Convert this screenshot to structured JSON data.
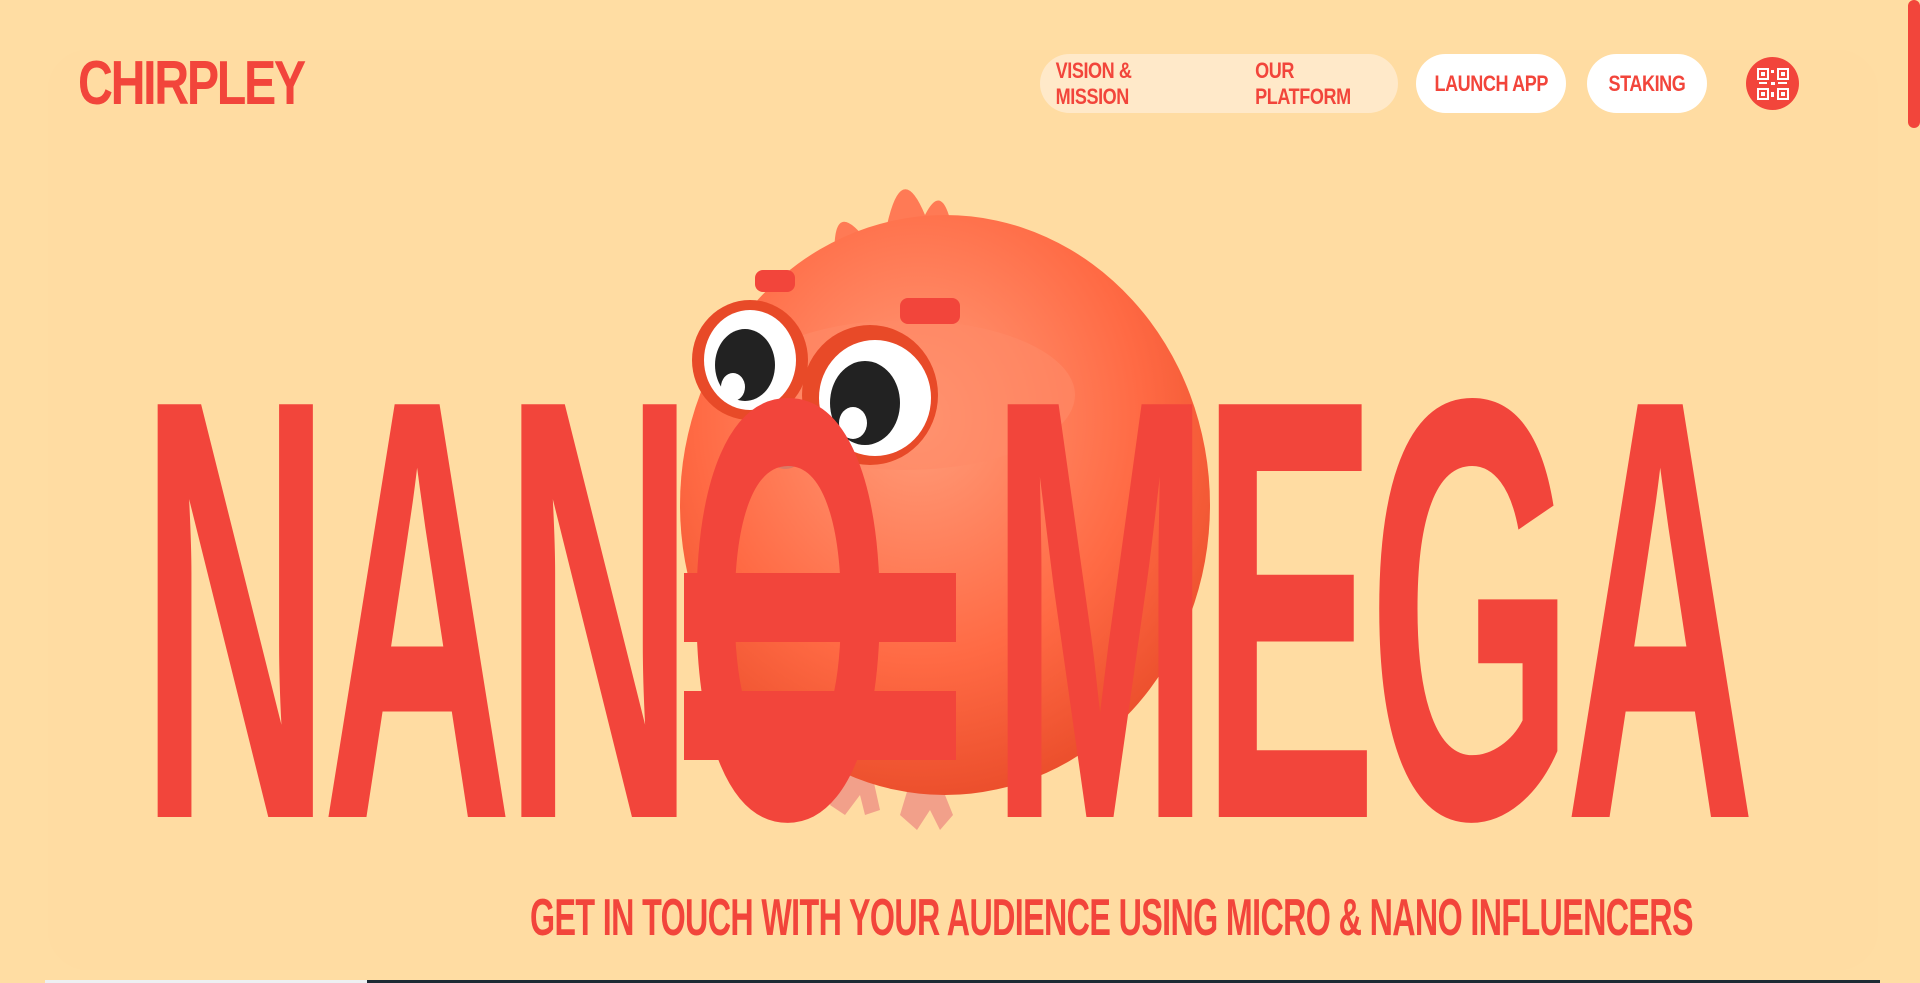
{
  "logo": {
    "text": "CHIRPLEY"
  },
  "nav": {
    "vision": "VISION & MISSION",
    "platform": "OUR PLATFORM"
  },
  "buttons": {
    "launch": "LAUNCH APP",
    "staking": "STAKING"
  },
  "hero": {
    "left_word": "NANO",
    "right_word": "MEGA",
    "tagline": "GET IN TOUCH WITH YOUR AUDIENCE USING MICRO & NANO INFLUENCERS"
  },
  "icons": {
    "qr": "qr-code-icon",
    "mascot": "bird-mascot"
  },
  "colors": {
    "background": "#ffdca2",
    "accent": "#f2453b",
    "pill": "#ffe9c9",
    "button": "#ffffff"
  }
}
